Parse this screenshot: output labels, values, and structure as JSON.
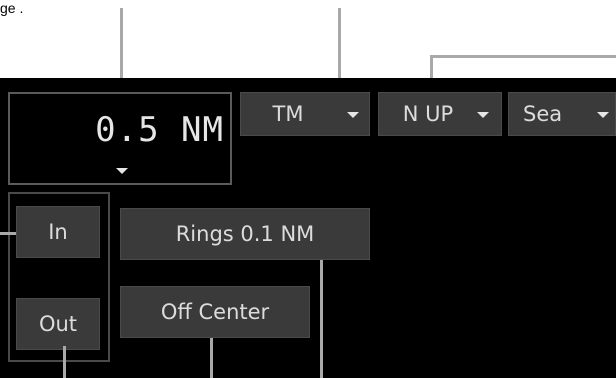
{
  "caption_fragment": "ge .",
  "range": {
    "value": "0.5 NM",
    "icon": "chevron-down-icon"
  },
  "display_mode": {
    "label": "TM",
    "icon": "chevron-down-icon"
  },
  "orientation": {
    "label": "N UP",
    "icon": "chevron-down-icon"
  },
  "sea_stab": {
    "label": "Sea",
    "icon": "chevron-down-icon"
  },
  "zoom": {
    "in_label": "In",
    "out_label": "Out"
  },
  "rings": {
    "label": "Rings 0.1 NM"
  },
  "off_center": {
    "label": "Off Center"
  },
  "colors": {
    "panel_bg": "#000000",
    "button_bg": "#3a3a3a",
    "button_text": "#dcdcdc",
    "leader_line": "#a9a9a9"
  }
}
